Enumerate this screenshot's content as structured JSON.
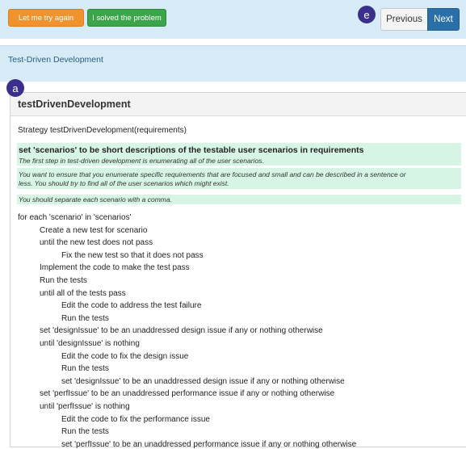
{
  "toolbar": {
    "retry_label": "Let me try again",
    "solved_label": "I solved the problem",
    "previous_label": "Previous",
    "next_label": "Next",
    "badge_e": "e"
  },
  "header": {
    "title": "Test-Driven Development"
  },
  "panel": {
    "badge_a": "a",
    "title": "testDrivenDevelopment",
    "signature": "Strategy testDrivenDevelopment(requirements)",
    "step": {
      "statement": "set 'scenarios' to be short descriptions of the testable user scenarios in requirements",
      "note": "The first step in test-driven development is enumerating all of the user scenarios."
    },
    "hint1": {
      "line1": "You want to ensure that you enumerate specific requirements that are focused and small and can be described in a sentence or",
      "line2": "less. You should try to find all of the user scenarios which might exist."
    },
    "hint2": "You should separate each scenario with a comma.",
    "code": [
      {
        "indent": 0,
        "text": "for each 'scenario' in 'scenarios'"
      },
      {
        "indent": 1,
        "text": "Create a new test for scenario"
      },
      {
        "indent": 1,
        "text": "until the new test does not pass"
      },
      {
        "indent": 2,
        "text": "Fix the new test so that it does not pass"
      },
      {
        "indent": 1,
        "text": "Implement the code to make the test pass"
      },
      {
        "indent": 1,
        "text": "Run the tests"
      },
      {
        "indent": 1,
        "text": "until all of the tests pass"
      },
      {
        "indent": 2,
        "text": "Edit the code to address the test failure"
      },
      {
        "indent": 2,
        "text": "Run the tests"
      },
      {
        "indent": 1,
        "text": "set 'designIssue' to be an unaddressed design issue if any or nothing otherwise"
      },
      {
        "indent": 1,
        "text": "until 'designIssue' is nothing"
      },
      {
        "indent": 2,
        "text": "Edit the code to fix the design issue"
      },
      {
        "indent": 2,
        "text": "Run the tests"
      },
      {
        "indent": 2,
        "text": "set 'designIssue' to be an unaddressed design issue if any or nothing otherwise"
      },
      {
        "indent": 1,
        "text": "set 'perfIssue' to be an unaddressed performance issue if any or nothing otherwise"
      },
      {
        "indent": 1,
        "text": "until 'perfIssue' is nothing"
      },
      {
        "indent": 2,
        "text": "Edit the code to fix the performance issue"
      },
      {
        "indent": 2,
        "text": "Run the tests"
      },
      {
        "indent": 2,
        "text": "set 'perfIssue' to be an unaddressed performance issue if any or nothing otherwise"
      }
    ]
  }
}
